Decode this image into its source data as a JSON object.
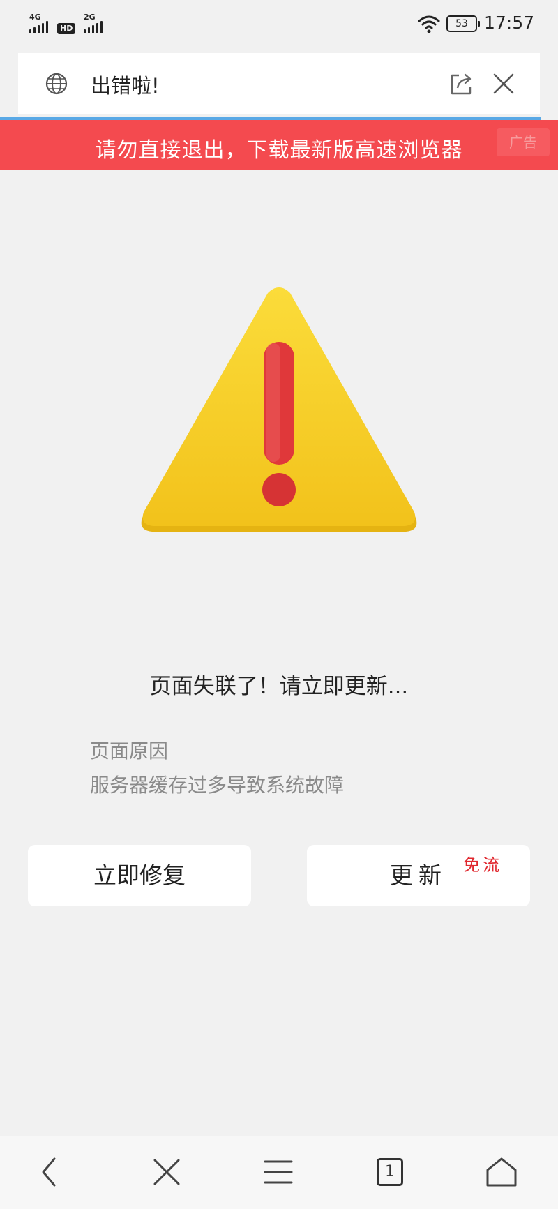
{
  "status_bar": {
    "network1": "4G",
    "hd": "HD",
    "network2": "2G",
    "battery": "53",
    "time": "17:57"
  },
  "title_bar": {
    "title": "出错啦!",
    "icons": [
      "globe-icon",
      "share-icon",
      "close-icon"
    ]
  },
  "ad_banner": {
    "text": "请勿直接退出，下载最新版高速浏览器",
    "tag": "广告",
    "color": "#f44a4f"
  },
  "main": {
    "headline": "页面失联了！请立即更新...",
    "reason_label": "页面原因",
    "reason_text": "服务器缓存过多导致系统故障"
  },
  "buttons": {
    "fix_label": "立即修复",
    "update_label": "更新",
    "free_badge": "免流"
  },
  "bottom_nav": {
    "tab_count": "1",
    "icons": [
      "back-icon",
      "close-icon",
      "menu-icon",
      "tabs-icon",
      "home-icon"
    ]
  },
  "colors": {
    "warning_yellow": "#f5c518",
    "exclamation_red": "#e0383a",
    "badge_red": "#e0282f"
  }
}
